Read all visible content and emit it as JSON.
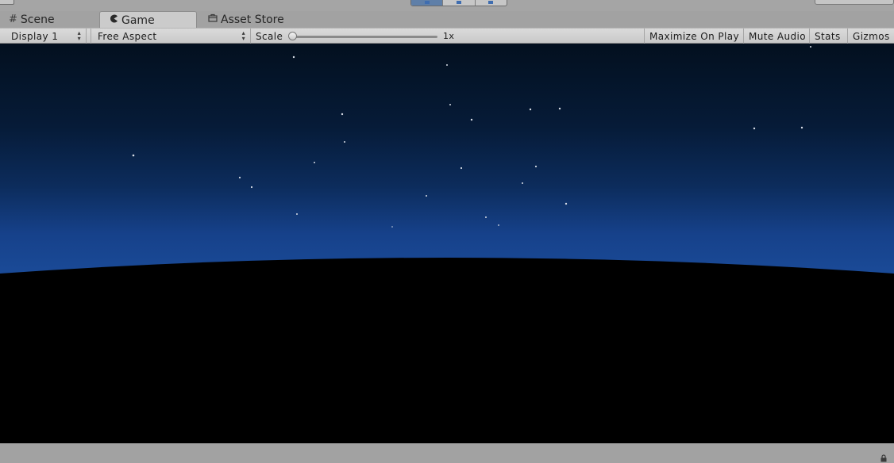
{
  "tabs": [
    {
      "label": "Scene",
      "icon": "grid-icon"
    },
    {
      "label": "Game",
      "icon": "pacman-icon",
      "active": true
    },
    {
      "label": "Asset Store",
      "icon": "bag-icon"
    }
  ],
  "toolbar": {
    "display": "Display 1",
    "aspect": "Free Aspect",
    "scale_label": "Scale",
    "scale_value": "1x",
    "maximize": "Maximize On Play",
    "mute": "Mute Audio",
    "stats": "Stats",
    "gizmos": "Gizmos"
  },
  "colors": {
    "sky_top": "#041226",
    "sky_horizon": "#16418a",
    "ground": "#000000",
    "active_play": "#3f6db0"
  }
}
